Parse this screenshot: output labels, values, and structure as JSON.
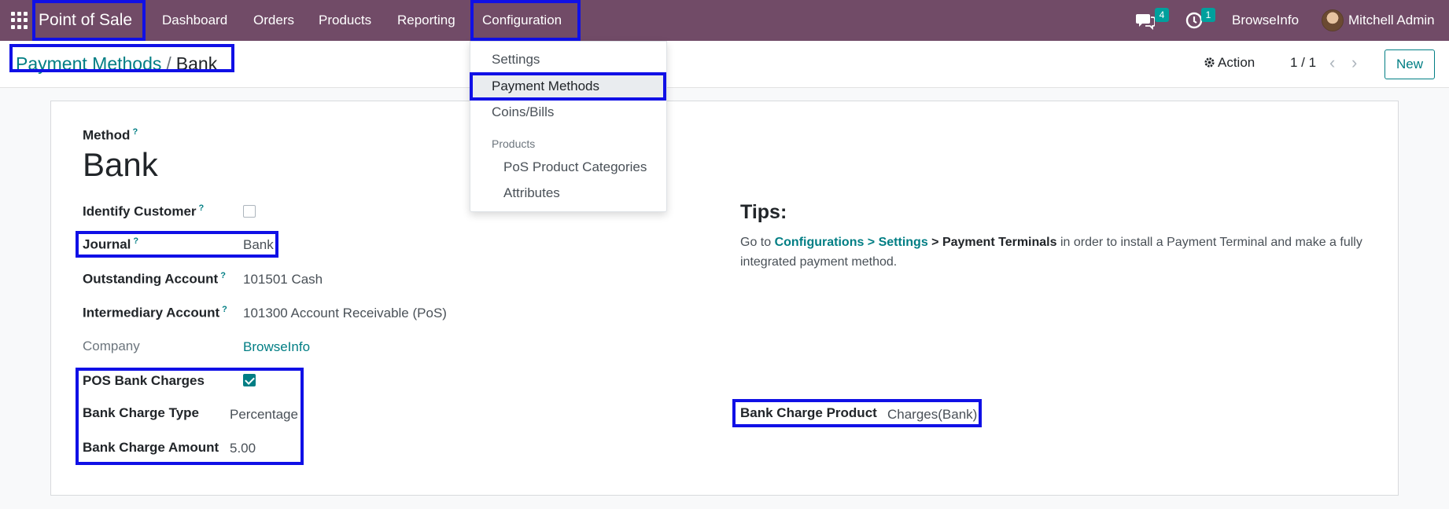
{
  "navbar": {
    "brand": "Point of Sale",
    "menu": [
      "Dashboard",
      "Orders",
      "Products",
      "Reporting",
      "Configuration"
    ],
    "messages_count": "4",
    "activities_count": "1",
    "company": "BrowseInfo",
    "user": "Mitchell Admin"
  },
  "breadcrumb": {
    "parent": "Payment Methods",
    "separator": "/",
    "current": "Bank"
  },
  "control": {
    "action": "Action",
    "pager": "1 / 1",
    "new": "New"
  },
  "dropdown": {
    "items": [
      "Settings",
      "Payment Methods",
      "Coins/Bills"
    ],
    "section": "Products",
    "sub_items": [
      "PoS Product Categories",
      "Attributes"
    ]
  },
  "form": {
    "method_label": "Method",
    "method_name": "Bank",
    "identify_customer_label": "Identify Customer",
    "identify_customer": false,
    "journal_label": "Journal",
    "journal": "Bank",
    "outstanding_label": "Outstanding Account",
    "outstanding": "101501 Cash",
    "intermediary_label": "Intermediary Account",
    "intermediary": "101300 Account Receivable (PoS)",
    "company_label": "Company",
    "company": "BrowseInfo",
    "pos_bank_charges_label": "POS Bank Charges",
    "pos_bank_charges": true,
    "bank_charge_type_label": "Bank Charge Type",
    "bank_charge_type": "Percentage",
    "bank_charge_amount_label": "Bank Charge Amount",
    "bank_charge_amount": "5.00",
    "bank_charge_product_label": "Bank Charge Product",
    "bank_charge_product": "Charges(Bank)"
  },
  "tips": {
    "title": "Tips:",
    "prefix": "Go to",
    "link": "Configurations > Settings",
    "middle": "> Payment Terminals",
    "suffix": "in order to install a Payment Terminal and make a fully integrated payment method."
  },
  "help_mark": "?",
  "colors": {
    "navbar": "#714b67",
    "accent": "#017e84",
    "highlight": "#1010e6"
  }
}
